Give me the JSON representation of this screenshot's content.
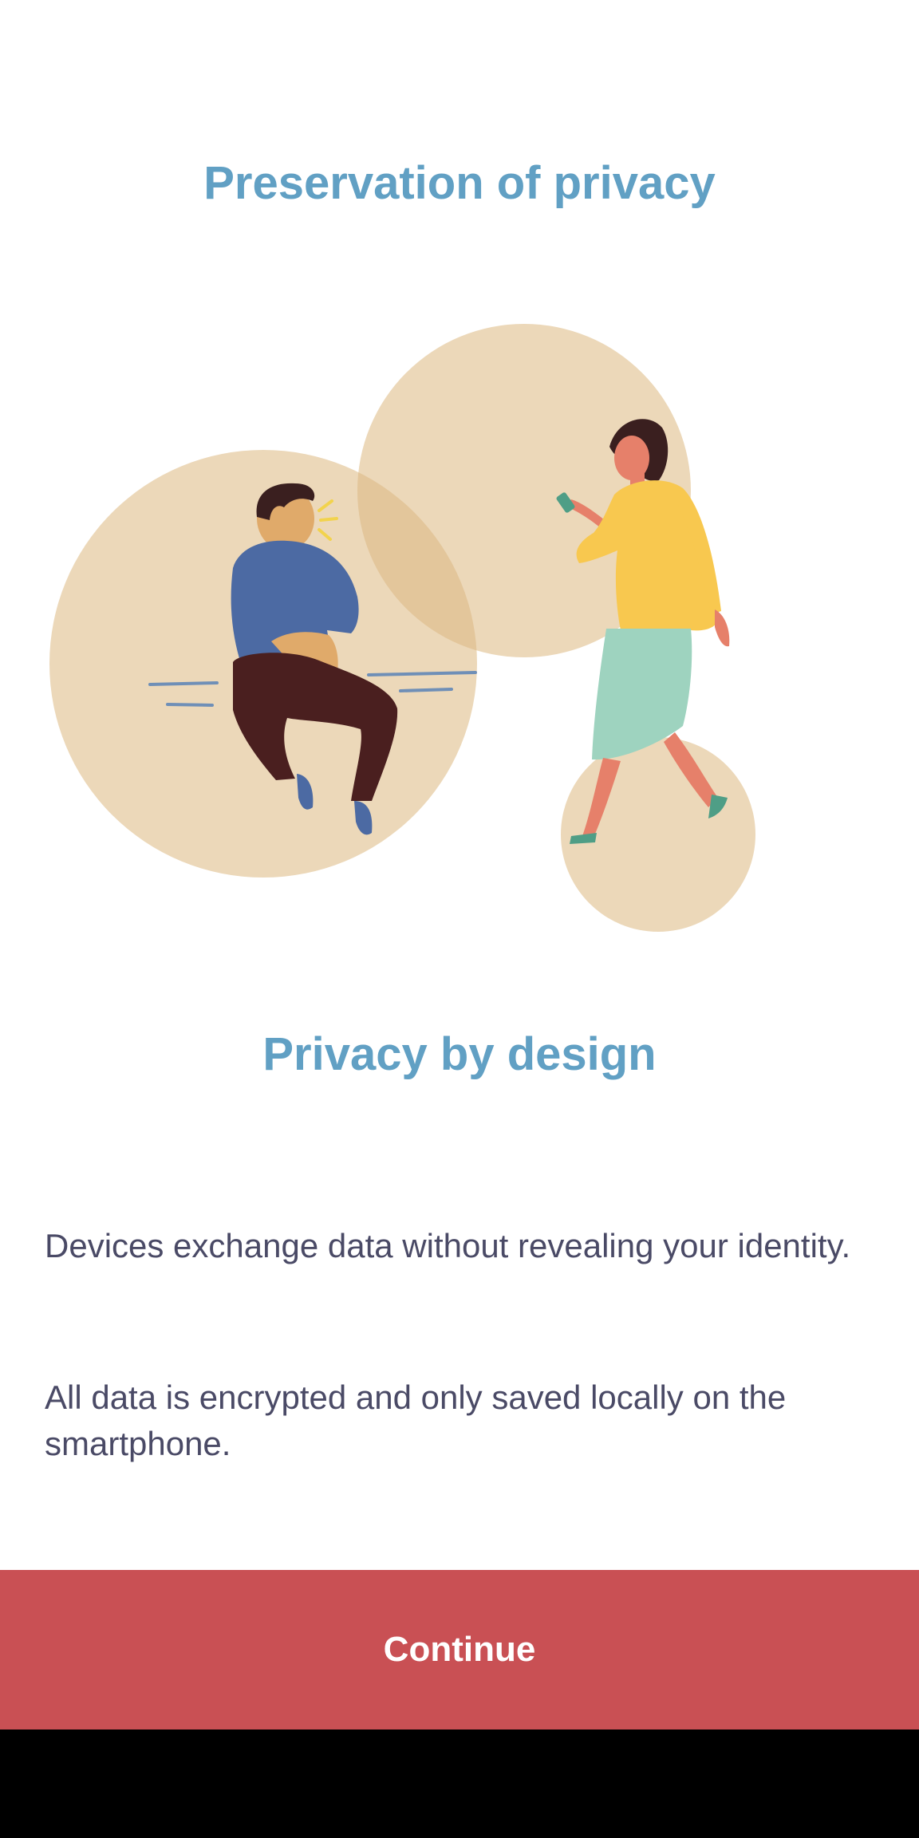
{
  "header": {
    "title": "Preservation of privacy"
  },
  "illustration": {
    "icon": "privacy-people-illustration",
    "colors": {
      "circle": "#ecd8b9",
      "overlap": "#e3c69b",
      "shirt_blue": "#4c6aa3",
      "pants_dark": "#4a1f1f",
      "skin_man": "#e0aa6a",
      "skin_woman": "#e6806a",
      "top_yellow": "#f8c84f",
      "skirt_mint": "#9ed3bf",
      "hair_dark": "#3a1f1f"
    }
  },
  "section": {
    "title": "Privacy by design",
    "paragraphs": [
      "Devices exchange data without revealing your identity.",
      "All data is encrypted and only saved locally on the smartphone."
    ]
  },
  "actions": {
    "continue_label": "Continue"
  },
  "theme": {
    "accent": "#61a0c4",
    "button": "#c95054",
    "text": "#4a4a66"
  }
}
